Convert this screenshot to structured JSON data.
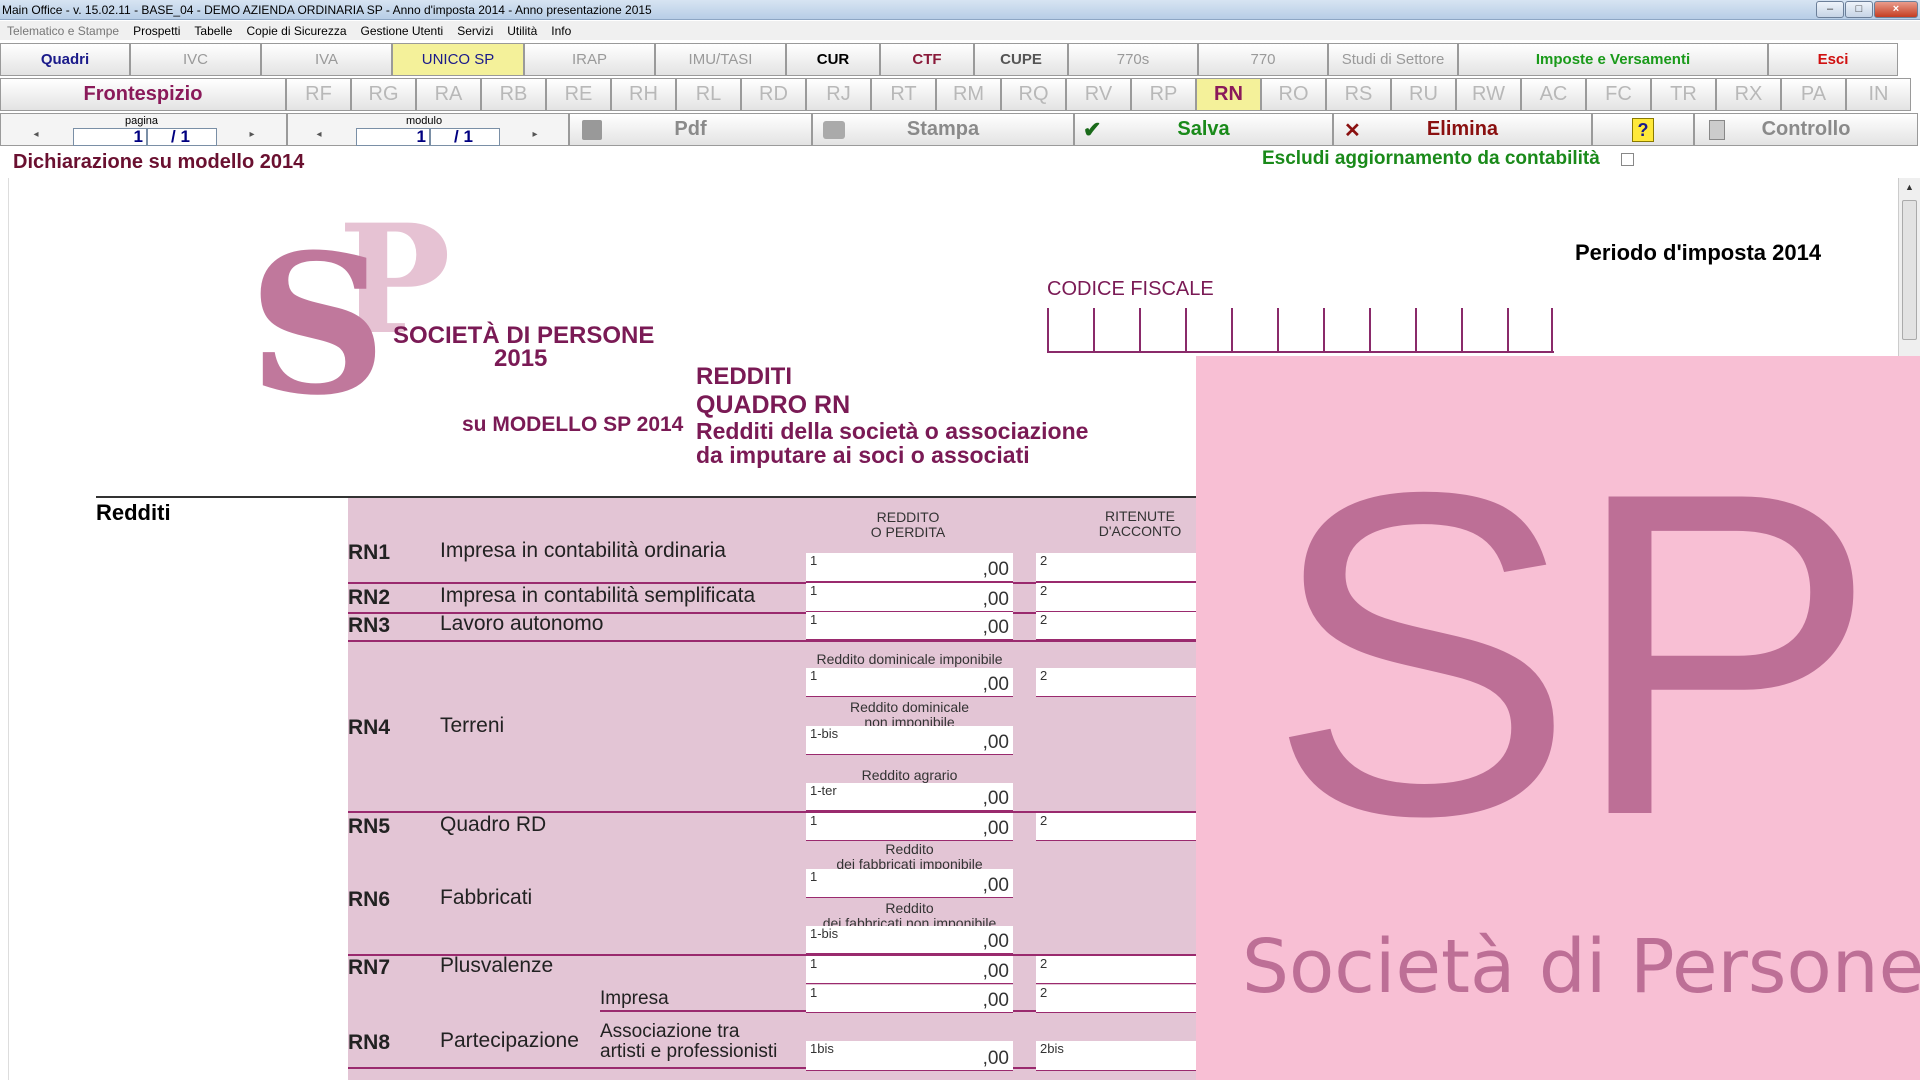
{
  "window": {
    "title": "Main Office - v. 15.02.11 - BASE_04 - DEMO AZIENDA ORDINARIA SP - Anno d'imposta 2014 - Anno presentazione 2015",
    "controls": [
      "–",
      "□",
      "×"
    ]
  },
  "menu": [
    {
      "label": "Telematico e Stampe",
      "enabled": false
    },
    {
      "label": "Prospetti",
      "enabled": true
    },
    {
      "label": "Tabelle",
      "enabled": true
    },
    {
      "label": "Copie di Sicurezza",
      "enabled": true
    },
    {
      "label": "Gestione Utenti",
      "enabled": true
    },
    {
      "label": "Servizi",
      "enabled": true
    },
    {
      "label": "Utilità",
      "enabled": true
    },
    {
      "label": "Info",
      "enabled": true
    }
  ],
  "toolbar1": [
    {
      "label": "Quadri",
      "w": 130,
      "color": "#1a1a8a",
      "bold": true,
      "bg": ""
    },
    {
      "label": "IVC",
      "w": 131,
      "color": "#9a9a9a",
      "bold": false,
      "bg": ""
    },
    {
      "label": "IVA",
      "w": 131,
      "color": "#9a9a9a",
      "bold": false,
      "bg": ""
    },
    {
      "label": "UNICO SP",
      "w": 132,
      "color": "#1a1a8a",
      "bold": false,
      "bg": "#f4f19a"
    },
    {
      "label": "IRAP",
      "w": 131,
      "color": "#9a9a9a",
      "bold": false,
      "bg": ""
    },
    {
      "label": "IMU/TASI",
      "w": 131,
      "color": "#9a9a9a",
      "bold": false,
      "bg": ""
    },
    {
      "label": "CUR",
      "w": 94,
      "color": "#000",
      "bold": true,
      "bg": ""
    },
    {
      "label": "CTF",
      "w": 94,
      "color": "#8a1a3a",
      "bold": true,
      "bg": ""
    },
    {
      "label": "CUPE",
      "w": 94,
      "color": "#555",
      "bold": true,
      "bg": ""
    },
    {
      "label": "770s",
      "w": 130,
      "color": "#9a9a9a",
      "bold": false,
      "bg": ""
    },
    {
      "label": "770",
      "w": 130,
      "color": "#9a9a9a",
      "bold": false,
      "bg": ""
    },
    {
      "label": "Studi di Settore",
      "w": 130,
      "color": "#9a9a9a",
      "bold": false,
      "bg": ""
    },
    {
      "label": "Imposte e Versamenti",
      "w": 310,
      "color": "#1a9a1a",
      "bold": true,
      "bg": ""
    },
    {
      "label": "Esci",
      "w": 130,
      "color": "#d01010",
      "bold": true,
      "bg": ""
    }
  ],
  "toolbar2": {
    "frontespizio": "Frontespizio",
    "quadri": [
      "RF",
      "RG",
      "RA",
      "RB",
      "RE",
      "RH",
      "RL",
      "RD",
      "RJ",
      "RT",
      "RM",
      "RQ",
      "RV",
      "RP",
      "RN",
      "RO",
      "RS",
      "RU",
      "RW",
      "AC",
      "FC",
      "TR",
      "RX",
      "PA",
      "IN"
    ],
    "active": "RN"
  },
  "toolbar3": {
    "pagina_label": "pagina",
    "pagina_value": "1",
    "pagina_total": "/ 1",
    "modulo_label": "modulo",
    "modulo_value": "1",
    "modulo_total": "/ 1",
    "pdf": "Pdf",
    "stampa": "Stampa",
    "salva": "Salva",
    "elimina": "Elimina",
    "help": "?",
    "controllo": "Controllo"
  },
  "header": {
    "doc_title": "Dichiarazione su modello 2014",
    "exclude_label": "Escludi aggiornamento da contabilità",
    "exclude_checked": false
  },
  "form": {
    "logo_s": "S",
    "logo_p": "P",
    "title1": "SOCIETÀ DI PERSONE",
    "title2": "2015",
    "su_modello": "su MODELLO SP 2014",
    "redditi": "REDDITI",
    "quadro": "QUADRO RN",
    "desc1": "Redditi della società o associazione",
    "desc2": "da imputare ai soci o associati",
    "periodo": "Periodo d'imposta 2014",
    "codice_fiscale": "CODICE FISCALE",
    "section": "Redditi",
    "col1": "REDDITO\nO PERDITA",
    "col2": "RITENUTE\nD'ACCONTO",
    "lines": [
      {
        "code": "RN1",
        "desc": "Impresa in contabilità ordinaria"
      },
      {
        "code": "RN2",
        "desc": "Impresa in contabilità semplificata"
      },
      {
        "code": "RN3",
        "desc": "Lavoro autonomo"
      },
      {
        "code": "RN4",
        "desc": "Terreni"
      },
      {
        "code": "RN5",
        "desc": "Quadro RD"
      },
      {
        "code": "RN6",
        "desc": "Fabbricati"
      },
      {
        "code": "RN7",
        "desc": "Plusvalenze"
      },
      {
        "code": "RN8",
        "desc": "Partecipazione",
        "sub1": "Impresa",
        "sub2a": "Associazione tra",
        "sub2b": "artisti e professionisti"
      }
    ],
    "rn4_labels": [
      "Reddito dominicale imponibile",
      "Reddito dominicale\nnon imponibile",
      "Reddito agrario"
    ],
    "rn6_labels": [
      "Reddito\ndei fabbricati imponibile",
      "Reddito\ndei fabbricati non imponibile"
    ],
    "box_nums": {
      "n1": "1",
      "n2": "2",
      "n1bis": "1-bis",
      "n1ter": "1-ter",
      "n1bis_b": "1bis",
      "n2bis": "2bis"
    },
    "amount": ",00"
  },
  "splash": {
    "sp": "SP",
    "text": "Società di Persone",
    "color": "#bd6f96",
    "bg": "#f8bfd4"
  }
}
